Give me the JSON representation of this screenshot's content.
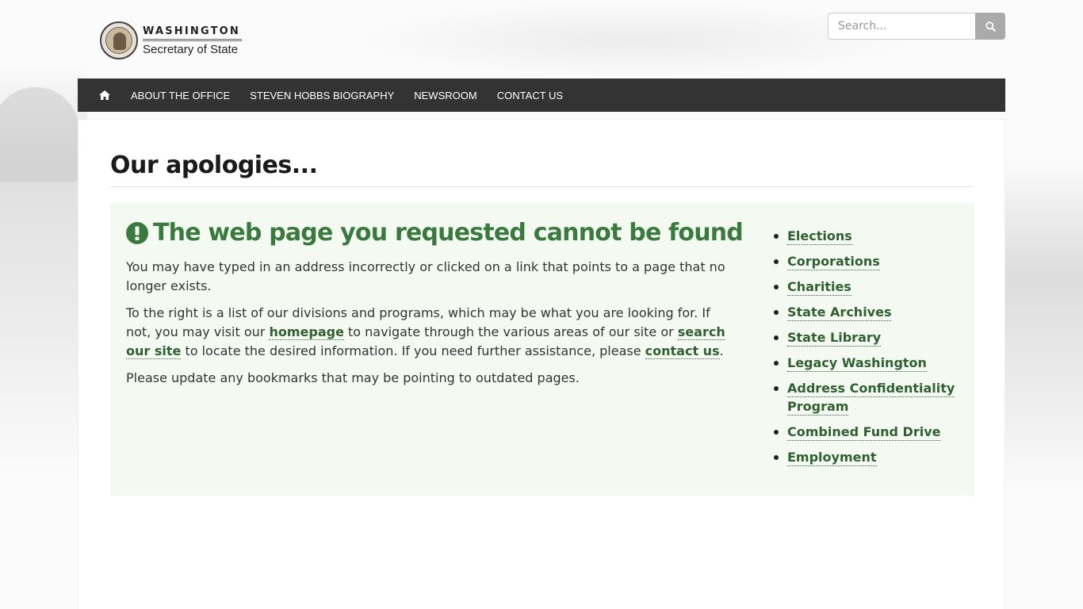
{
  "header": {
    "logo_line1": "WASHINGTON",
    "logo_line2": "Secretary of State",
    "search_placeholder": "Search..."
  },
  "nav": {
    "items": [
      {
        "label": "ABOUT THE OFFICE"
      },
      {
        "label": "STEVEN HOBBS BIOGRAPHY"
      },
      {
        "label": "NEWSROOM"
      },
      {
        "label": "CONTACT US"
      }
    ]
  },
  "main": {
    "title": "Our apologies...",
    "heading": "The web page you requested cannot be found",
    "para1": "You may have typed in an address incorrectly or clicked on a link that points to a page that no longer exists.",
    "para2": {
      "t1": "To the right is a list of our divisions and programs, which may be what you are looking for. If not, you may visit our ",
      "link_homepage": "homepage",
      "t2": " to navigate through the various areas of our site or ",
      "link_search": "search our site",
      "t3": " to locate the desired information. If you need further assistance, please ",
      "link_contact": "contact us",
      "t4": "."
    },
    "para3": "Please update any bookmarks that may be pointing to outdated pages."
  },
  "sidebar": {
    "links": [
      {
        "label": "Elections"
      },
      {
        "label": "Corporations"
      },
      {
        "label": "Charities"
      },
      {
        "label": "State Archives"
      },
      {
        "label": "State Library"
      },
      {
        "label": "Legacy Washington"
      },
      {
        "label": "Address Confidentiality Program"
      },
      {
        "label": "Combined Fund Drive"
      },
      {
        "label": "Employment"
      }
    ]
  },
  "colors": {
    "nav_bg": "#333333",
    "accent_green": "#3a7a3e",
    "panel_bg": "#f4faf2"
  },
  "icons": {
    "home": "home-icon",
    "search": "search-icon",
    "alert": "exclamation-circle-icon"
  }
}
